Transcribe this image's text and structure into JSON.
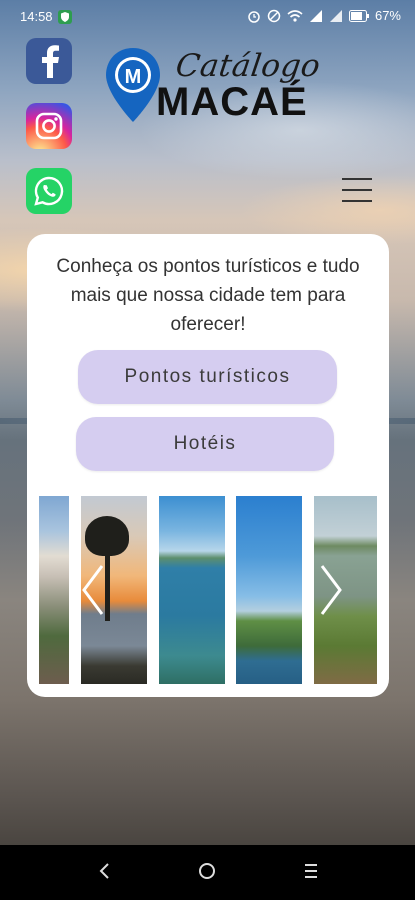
{
  "status_bar": {
    "time": "14:58",
    "battery_percent": "67%"
  },
  "social": [
    {
      "name": "facebook-icon",
      "color": "#3b5998"
    },
    {
      "name": "instagram-icon",
      "color": "#d6249f"
    },
    {
      "name": "whatsapp-icon",
      "color": "#25d366"
    }
  ],
  "logo": {
    "title": "Catálogo",
    "city": "MACAÉ",
    "pin_color": "#1565c0"
  },
  "card": {
    "intro_text": "Conheça os pontos turísticos e tudo mais que nossa cidade tem para oferecer!",
    "buttons": {
      "tourist_spots": "Pontos turísticos",
      "hotels": "Hotéis"
    },
    "button_color": "#d5cdf0",
    "carousel": {
      "slides": [
        "beach-city-photo",
        "sunset-tree-photo",
        "seaside-photo",
        "coast-island-photo",
        "lagoon-photo"
      ]
    }
  }
}
